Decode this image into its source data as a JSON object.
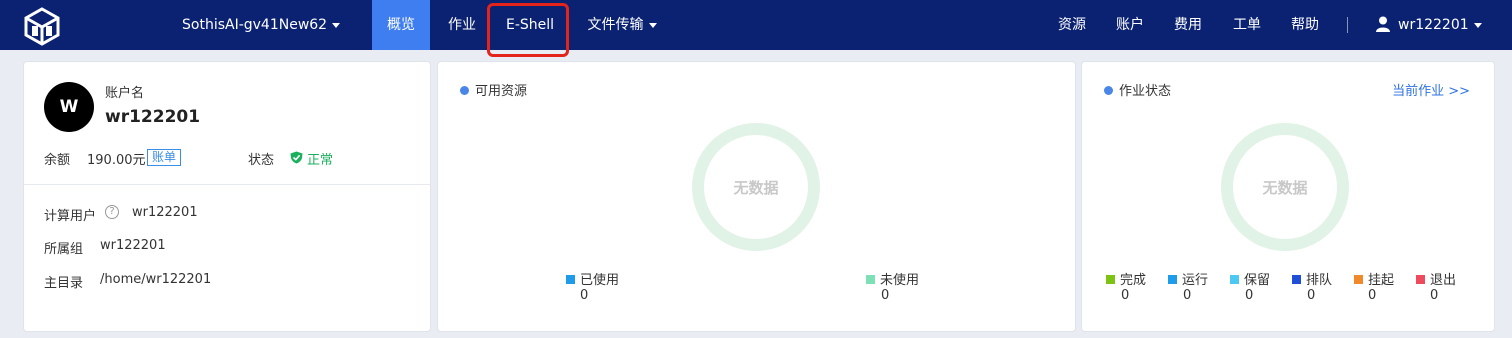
{
  "header": {
    "cluster": "SothisAI-gv41New62",
    "nav": [
      {
        "label": "概览"
      },
      {
        "label": "作业"
      },
      {
        "label": "E-Shell"
      },
      {
        "label": "文件传输"
      }
    ],
    "right_nav": [
      {
        "label": "资源"
      },
      {
        "label": "账户"
      },
      {
        "label": "费用"
      },
      {
        "label": "工单"
      },
      {
        "label": "帮助"
      }
    ],
    "user": "wr122201"
  },
  "account": {
    "avatar_letter": "W",
    "label": "账户名",
    "name": "wr122201",
    "balance_label": "余额",
    "balance_value": "190.00元",
    "bill_link": "账单",
    "status_label": "状态",
    "status_value": "正常",
    "rows": [
      {
        "label": "计算用户",
        "value": "wr122201"
      },
      {
        "label": "所属组",
        "value": "wr122201"
      },
      {
        "label": "主目录",
        "value": "/home/wr122201"
      }
    ]
  },
  "resources": {
    "title": "可用资源",
    "empty_text": "无数据",
    "legend": [
      {
        "label": "已使用",
        "value": "0",
        "color": "#1e9be9"
      },
      {
        "label": "未使用",
        "value": "0",
        "color": "#7ee0b6"
      }
    ]
  },
  "jobs": {
    "title": "作业状态",
    "link": "当前作业 >>",
    "empty_text": "无数据",
    "legend": [
      {
        "label": "完成",
        "value": "0",
        "color": "#7dc314"
      },
      {
        "label": "运行",
        "value": "0",
        "color": "#1e9be9"
      },
      {
        "label": "保留",
        "value": "0",
        "color": "#4dc8f0"
      },
      {
        "label": "排队",
        "value": "0",
        "color": "#1f4fd6"
      },
      {
        "label": "挂起",
        "value": "0",
        "color": "#f0892c"
      },
      {
        "label": "退出",
        "value": "0",
        "color": "#ef4b5f"
      }
    ]
  }
}
